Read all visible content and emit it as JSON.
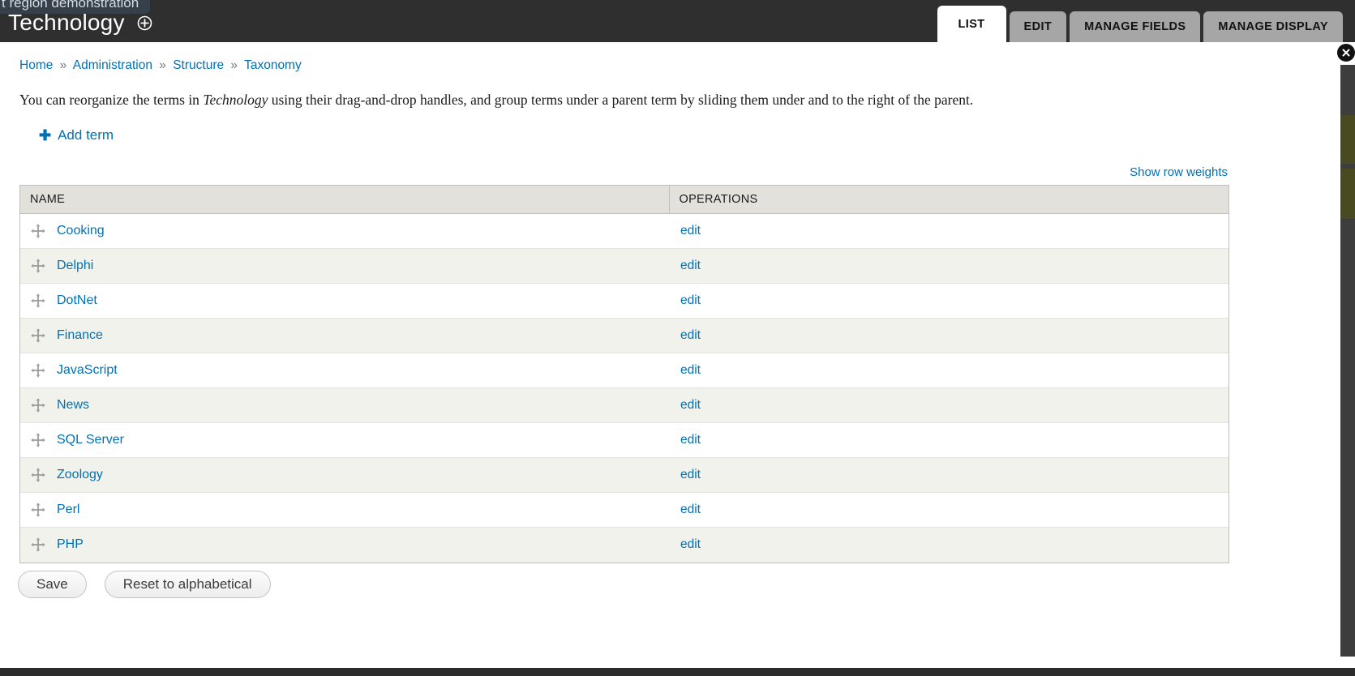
{
  "toolbar": {
    "clipped_tab_label": "t region demonstration",
    "page_title": "Technology",
    "title_icon": "plus-circle-icon"
  },
  "tabs": [
    {
      "label": "LIST",
      "active": true
    },
    {
      "label": "EDIT",
      "active": false
    },
    {
      "label": "MANAGE FIELDS",
      "active": false
    },
    {
      "label": "MANAGE DISPLAY",
      "active": false
    }
  ],
  "breadcrumb": {
    "items": [
      "Home",
      "Administration",
      "Structure",
      "Taxonomy"
    ],
    "separator": "»"
  },
  "help": {
    "part1": "You can reorganize the terms in ",
    "vocabulary": "Technology",
    "part2": " using their drag-and-drop handles, and group terms under a parent term by sliding them under and to the right of the parent."
  },
  "actions": {
    "add_term_label": "Add term",
    "add_term_icon": "plus-icon",
    "show_row_weights_label": "Show row weights"
  },
  "table": {
    "columns": [
      "NAME",
      "OPERATIONS"
    ],
    "drag_icon": "drag-handle-icon",
    "rows": [
      {
        "name": "Cooking",
        "operation": "edit"
      },
      {
        "name": "Delphi",
        "operation": "edit"
      },
      {
        "name": "DotNet",
        "operation": "edit"
      },
      {
        "name": "Finance",
        "operation": "edit"
      },
      {
        "name": "JavaScript",
        "operation": "edit"
      },
      {
        "name": "News",
        "operation": "edit"
      },
      {
        "name": "SQL Server",
        "operation": "edit"
      },
      {
        "name": "Zoology",
        "operation": "edit"
      },
      {
        "name": "Perl",
        "operation": "edit"
      },
      {
        "name": "PHP",
        "operation": "edit"
      }
    ]
  },
  "form_actions": {
    "save_label": "Save",
    "reset_label": "Reset to alphabetical"
  },
  "rail": {
    "close_icon": "close-icon"
  },
  "colors": {
    "link": "#0071b3",
    "toolbar_bg": "#2f2f2f",
    "tab_inactive_bg": "#a6a6a6",
    "table_header_bg": "#e2e1dc",
    "row_even_bg": "#f2f2ed"
  }
}
